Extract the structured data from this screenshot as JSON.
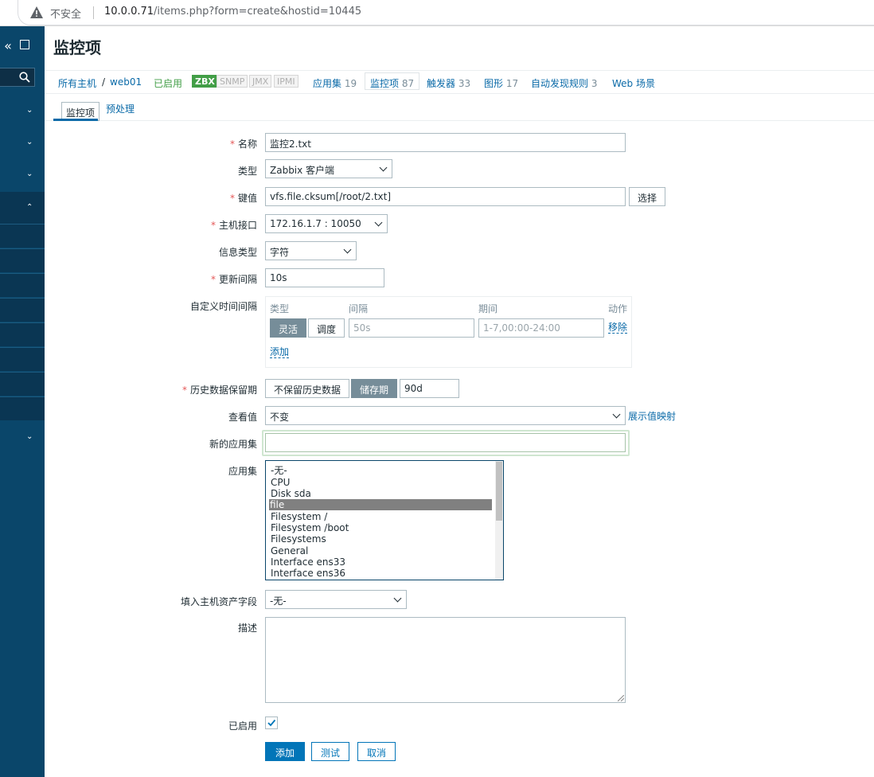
{
  "browser": {
    "security_label": "不安全",
    "url_host": "10.0.0.71",
    "url_path": "/items.php?form=create&hostid=10445"
  },
  "page": {
    "title": "监控项"
  },
  "nav": {
    "all_hosts": "所有主机",
    "separator": "/",
    "host": "web01",
    "status": "已启用",
    "badges": [
      "ZBX",
      "SNMP",
      "JMX",
      "IPMI"
    ],
    "links": [
      {
        "label": "应用集",
        "count": "19"
      },
      {
        "label": "监控项",
        "count": "87"
      },
      {
        "label": "触发器",
        "count": "33"
      },
      {
        "label": "图形",
        "count": "17"
      },
      {
        "label": "自动发现规则",
        "count": "3"
      },
      {
        "label": "Web 场景",
        "count": ""
      }
    ]
  },
  "subtabs": [
    "监控项",
    "预处理"
  ],
  "form": {
    "name_label": "名称",
    "name_value": "监控2.txt",
    "type_label": "类型",
    "type_value": "Zabbix 客户端",
    "key_label": "键值",
    "key_value": "vfs.file.cksum[/root/2.txt]",
    "select_button": "选择",
    "interface_label": "主机接口",
    "interface_value": "172.16.1.7 : 10050",
    "info_type_label": "信息类型",
    "info_type_value": "字符",
    "interval_label": "更新间隔",
    "interval_value": "10s",
    "custom_label": "自定义时间间隔",
    "custom_headers": [
      "类型",
      "间隔",
      "期间",
      "动作"
    ],
    "custom_flex": "灵活",
    "custom_sched": "调度",
    "custom_interval_ph": "50s",
    "custom_period_ph": "1-7,00:00-24:00",
    "custom_remove": "移除",
    "custom_add": "添加",
    "history_label": "历史数据保留期",
    "history_opt1": "不保留历史数据",
    "history_opt2": "储存期",
    "history_value": "90d",
    "valuemap_label": "查看值",
    "valuemap_value": "不变",
    "valuemap_link": "展示值映射",
    "new_app_label": "新的应用集",
    "new_app_value": "",
    "apps_label": "应用集",
    "apps": [
      "-无-",
      "CPU",
      "Disk sda",
      "file",
      "Filesystem /",
      "Filesystem /boot",
      "Filesystems",
      "General",
      "Interface ens33",
      "Interface ens36"
    ],
    "apps_selected": "file",
    "inventory_label": "填入主机资产字段",
    "inventory_value": "-无-",
    "desc_label": "描述",
    "enabled_label": "已启用",
    "buttons": {
      "add": "添加",
      "test": "测试",
      "cancel": "取消"
    }
  },
  "colors": {
    "sidebar": "#0a466a",
    "link": "#0a6aa8",
    "primary": "#0275b8",
    "enabled": "#429e47",
    "required": "#e45959"
  }
}
